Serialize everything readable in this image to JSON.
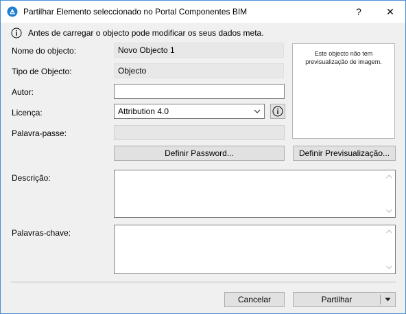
{
  "window": {
    "title": "Partilhar Elemento seleccionado no Portal Componentes BIM",
    "help_label": "?",
    "close_label": "✕"
  },
  "info": {
    "text": "Antes de carregar o objecto pode modificar os seus dados meta."
  },
  "form": {
    "name_label": "Nome do objecto:",
    "name_value": "Novo Objecto 1",
    "type_label": "Tipo de Objecto:",
    "type_value": "Objecto",
    "author_label": "Autor:",
    "author_value": "",
    "license_label": "Licença:",
    "license_value": "Attribution 4.0",
    "password_label": "Palavra-passe:",
    "password_value": "",
    "description_label": "Descrição:",
    "description_value": "",
    "keywords_label": "Palavras-chave:",
    "keywords_value": ""
  },
  "preview": {
    "text": "Este objecto não tem previsualização de imagem."
  },
  "buttons": {
    "set_password": "Definir Password...",
    "set_preview": "Definir Previsualização...",
    "cancel": "Cancelar",
    "share": "Partilhar"
  },
  "colors": {
    "window_border": "#4a8fd4",
    "dialog_background": "#f0f0f0",
    "button_face": "#e1e1e1",
    "app_icon": "#1f7fd1"
  },
  "icons": {
    "app": "archicad-icon",
    "info": "info-circle-icon",
    "license_info": "info-circle-icon",
    "dropdown": "chevron-down-icon",
    "split_menu": "triangle-down-icon"
  }
}
